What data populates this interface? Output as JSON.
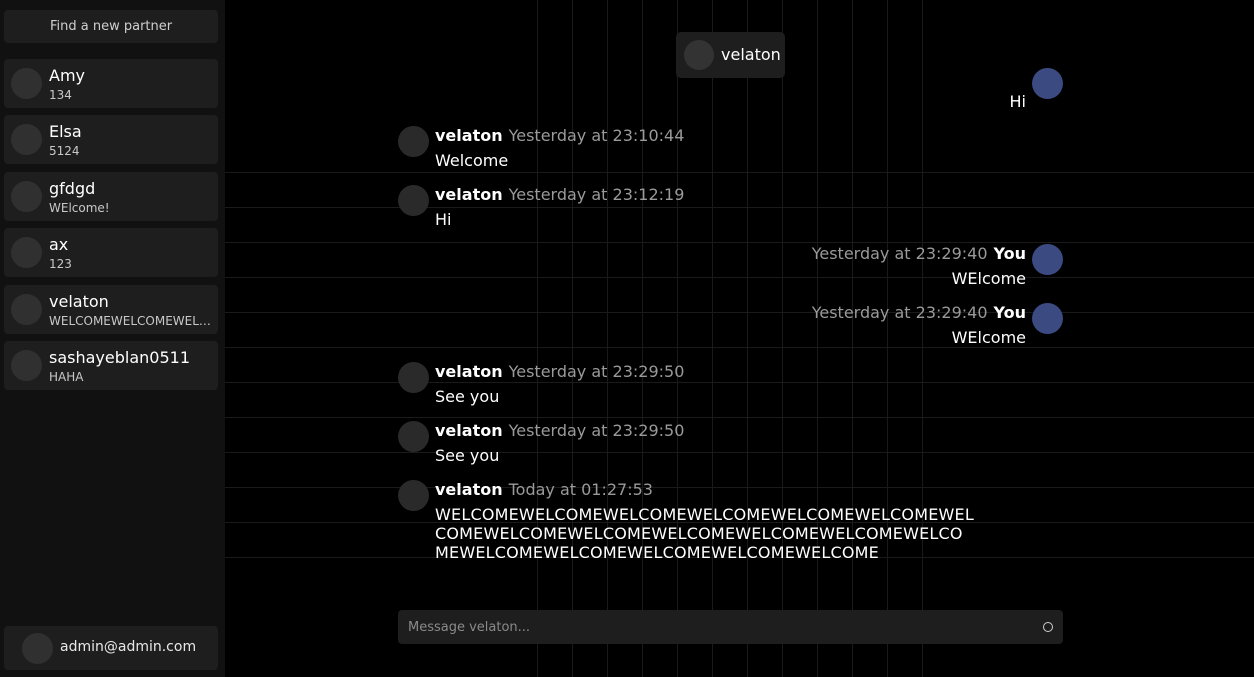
{
  "sidebar": {
    "find_label": "Find a new partner",
    "contacts": [
      {
        "name": "Amy",
        "last": "134"
      },
      {
        "name": "Elsa",
        "last": "5124"
      },
      {
        "name": "gfdgd",
        "last": "WElcome!"
      },
      {
        "name": "ax",
        "last": "123"
      },
      {
        "name": "velaton",
        "last": "WELCOMEWELCOMEWELCOMEWELCOME"
      },
      {
        "name": "sashayeblan0511",
        "last": "HAHA"
      }
    ],
    "account_email": "admin@admin.com"
  },
  "chat": {
    "partner": "velaton",
    "partial_top_text": "Hi",
    "messages": [
      {
        "author": "velaton",
        "time": "Yesterday at 23:10:44",
        "text": "Welcome"
      },
      {
        "author": "velaton",
        "time": "Yesterday at 23:12:19",
        "text": "Hi"
      },
      {
        "author": "You",
        "time": "Yesterday at 23:29:40",
        "text": "WElcome"
      },
      {
        "author": "You",
        "time": "Yesterday at 23:29:40",
        "text": "WElcome"
      },
      {
        "author": "velaton",
        "time": "Yesterday at 23:29:50",
        "text": "See you"
      },
      {
        "author": "velaton",
        "time": "Yesterday at 23:29:50",
        "text": "See you"
      },
      {
        "author": "velaton",
        "time": "Today at 01:27:53",
        "text": "WELCOMEWELCOMEWELCOMEWELCOMEWELCOMEWELCOMEWELCOMEWELCOMEWELCOMEWELCOMEWELCOMEWELCOMEWELCOMEWELCOMEWELCOMEWELCOMEWELCOMEWELCOME"
      }
    ],
    "composer_placeholder": "Message velaton...",
    "send_icon": "send-circle-icon"
  },
  "colors": {
    "self_avatar": "#3b4a80",
    "panel": "#1e1e1e"
  }
}
